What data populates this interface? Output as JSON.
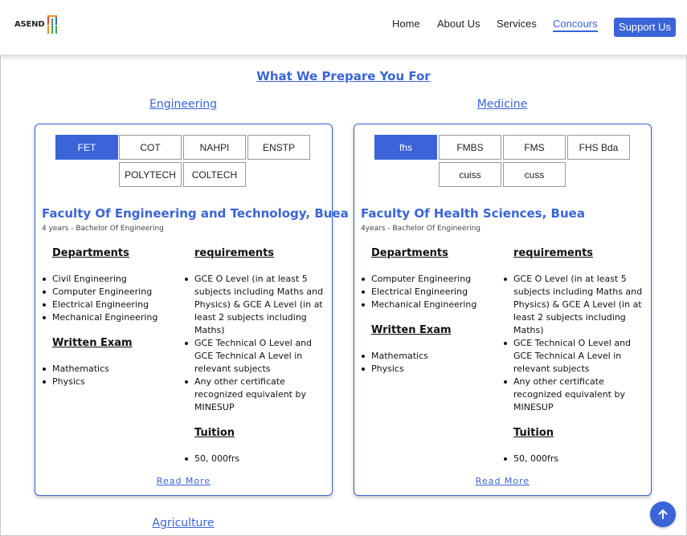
{
  "header": {
    "logo_text": "ASEND",
    "nav": [
      "Home",
      "About Us",
      "Services",
      "Concours"
    ],
    "active_nav": "Concours",
    "support_label": "Support Us"
  },
  "section_title": "What We Prepare You For",
  "columns": [
    {
      "title": "Engineering",
      "tabs_row1": [
        "FET",
        "COT",
        "NAHPI",
        "ENSTP"
      ],
      "tabs_row2": [
        "POLYTECH",
        "COLTECH"
      ],
      "active_tab": "FET",
      "faculty_name": "Faculty Of Engineering and Technology, Buea",
      "faculty_meta": "4 years - Bachelor Of Engineering",
      "departments_label": "Departments",
      "departments": [
        "Civil Engineering",
        "Computer Engineering",
        "Electrical Engineering",
        "Mechanical Engineering"
      ],
      "written_exam_label": "Written Exam",
      "written_exam": [
        "Mathematics",
        "Physics"
      ],
      "requirements_label": "requirements",
      "requirements": [
        "GCE O Level (in at least 5 subjects including Maths and Physics) & GCE A Level (in at least 2 subjects including Maths)",
        "GCE Technical O Level and GCE Technical A Level in relevant subjects",
        "Any other certificate recognized equivalent by MINESUP"
      ],
      "tuition_label": "Tuition",
      "tuition": [
        "50, 000frs"
      ],
      "read_more": "Read More"
    },
    {
      "title": "Medicine",
      "tabs_row1": [
        "fhs",
        "FMBS",
        "FMS",
        "FHS Bda"
      ],
      "tabs_row2": [
        "cuiss",
        "cuss"
      ],
      "active_tab": "fhs",
      "faculty_name": "Faculty Of Health Sciences, Buea",
      "faculty_meta": "4years - Bachelor Of Engineering",
      "departments_label": "Departments",
      "departments": [
        "Computer Engineering",
        "Electrical Engineering",
        "Mechanical Engineering"
      ],
      "written_exam_label": "Written Exam",
      "written_exam": [
        "Mathematics",
        "Physics"
      ],
      "requirements_label": "requirements",
      "requirements": [
        "GCE O Level (in at least 5 subjects including Maths and Physics) & GCE A Level (in at least 2 subjects including Maths)",
        "GCE Technical O Level and GCE Technical A Level in relevant subjects",
        "Any other certificate recognized equivalent by MINESUP"
      ],
      "tuition_label": "Tuition",
      "tuition": [
        "50, 000frs"
      ],
      "read_more": "Read More"
    }
  ],
  "next_section_title": "Agriculture",
  "colors": {
    "accent": "#3a64d8",
    "logo_orange": "#f08a24",
    "logo_green": "#3aa655",
    "logo_blue": "#3a64d8",
    "logo_red": "#e04040"
  },
  "icons": {
    "scroll_top": "arrow-up-icon"
  }
}
